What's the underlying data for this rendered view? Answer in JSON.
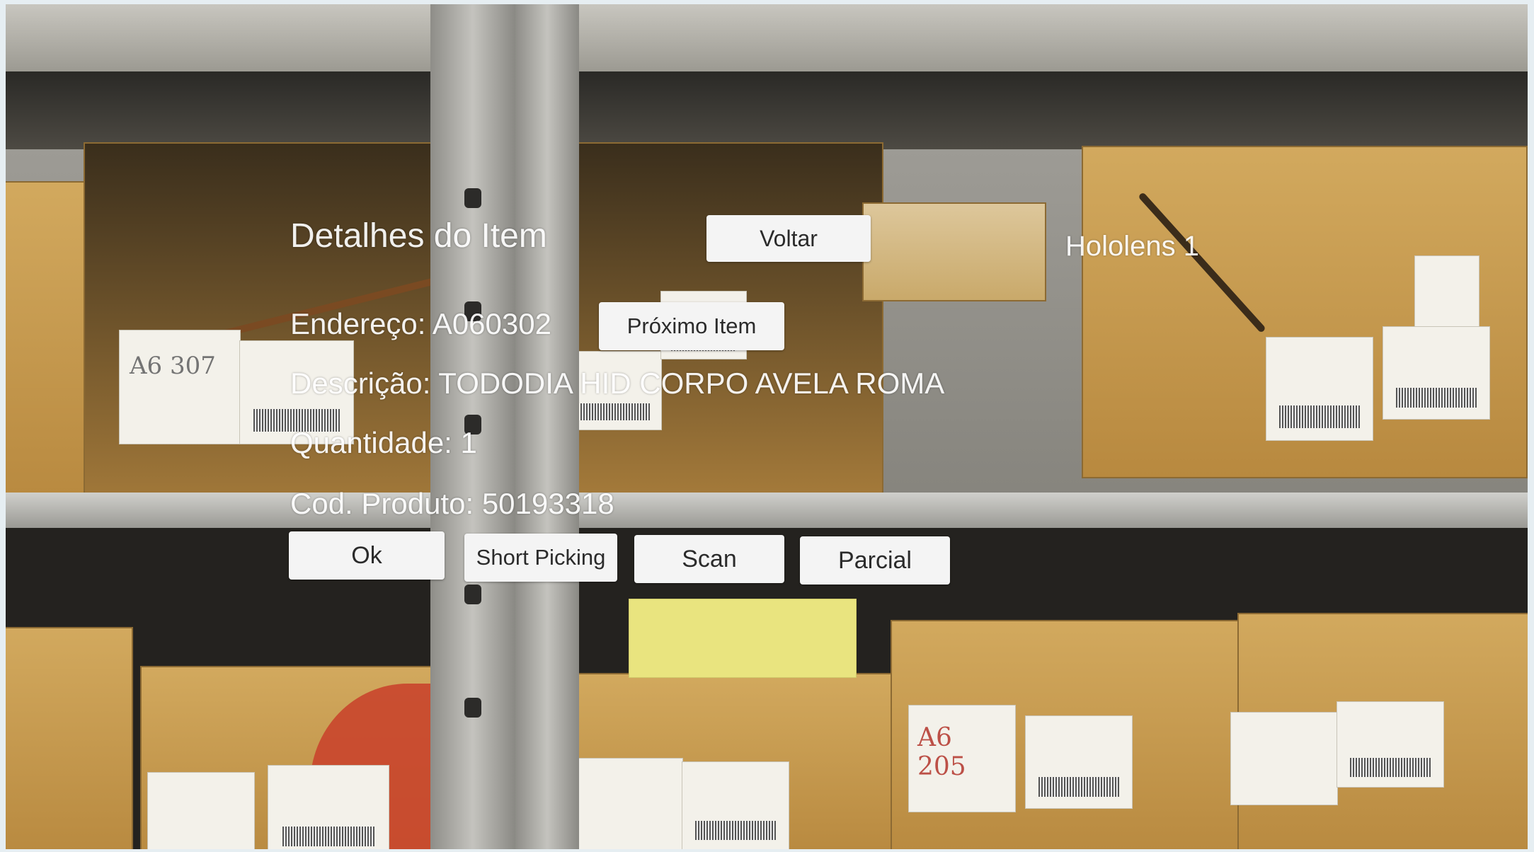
{
  "panel": {
    "title": "Detalhes do Item",
    "device_label": "Hololens 1",
    "buttons": {
      "back": "Voltar",
      "next_item": "Próximo Item",
      "ok": "Ok",
      "short_picking": "Short Picking",
      "scan": "Scan",
      "partial": "Parcial"
    },
    "fields": {
      "address": "Endereço: A060302",
      "description": "Descrição: TODODIA HID CORPO AVELA ROMA",
      "quantity": "Quantidade: 1",
      "product_code": "Cod. Produto: 50193318"
    }
  },
  "scene": {
    "box_labels": [
      "A6 307",
      "A6 205"
    ]
  },
  "colors": {
    "cardboard": "#c9a05a",
    "shelf_metal": "#b7b6b0",
    "button_bg": "#f4f4f4",
    "ui_text": "#ffffff"
  }
}
